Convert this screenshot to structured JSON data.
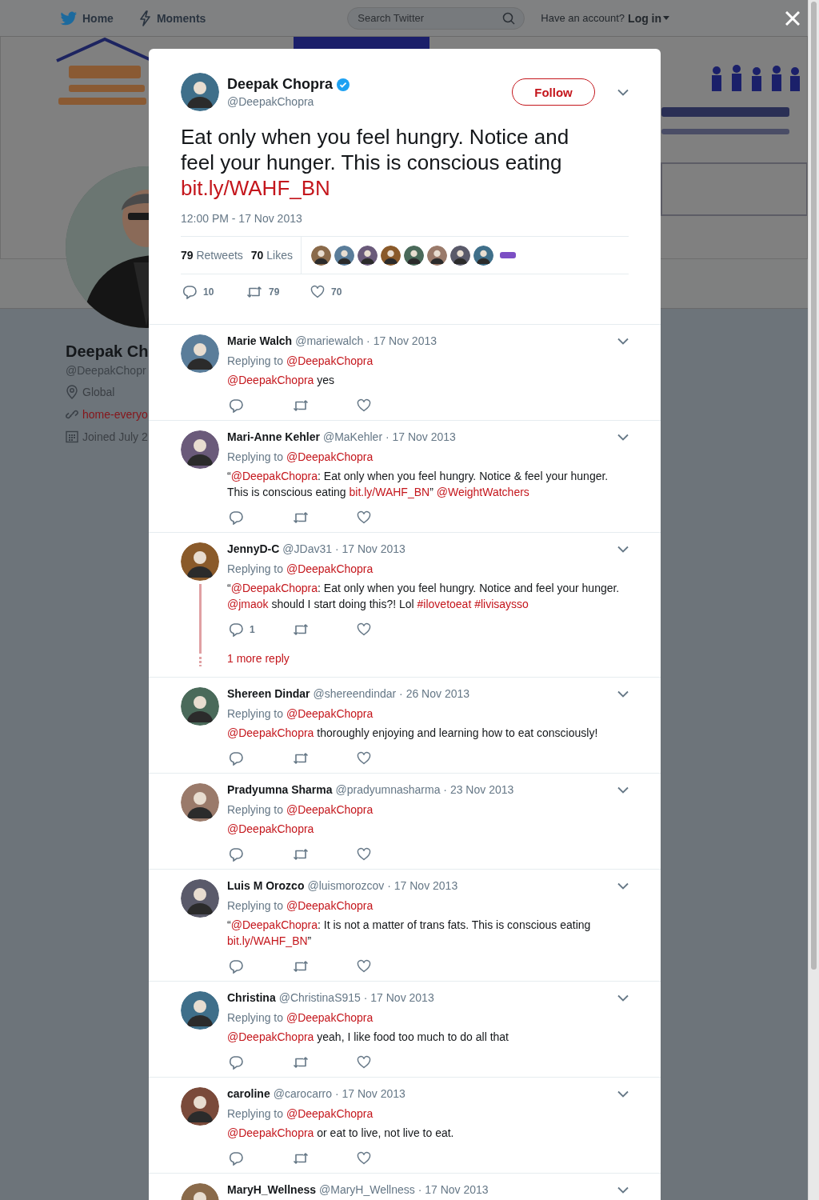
{
  "nav": {
    "items": [
      {
        "label": "Home",
        "kind": "home"
      },
      {
        "label": "Moments",
        "kind": "moments"
      }
    ],
    "search": {
      "placeholder": "Search Twitter"
    },
    "account_prompt": "Have an account?",
    "login": "Log in"
  },
  "profile": {
    "name": "Deepak Ch",
    "handle": "@DeepakChopr",
    "details": [
      {
        "kind": "location",
        "text": "Global"
      },
      {
        "kind": "link",
        "text": "home-everyo"
      },
      {
        "kind": "joined",
        "text": "Joined July 2"
      }
    ]
  },
  "tweet": {
    "name": "Deepak Chopra",
    "verified": true,
    "handle": "@DeepakChopra",
    "follow": "Follow",
    "text": [
      {
        "kind": "plain",
        "text": "Eat only when you feel hungry. Notice and feel your hunger. This is conscious eating "
      },
      {
        "kind": "url",
        "text": "bit.ly/WAHF_BN"
      }
    ],
    "time": "12:00 PM - 17 Nov 2013",
    "retweets": "**79** Retweets",
    "likes": "**70** Likes",
    "likers": [
      {
        "kind": "picture"
      },
      {
        "kind": "picture"
      },
      {
        "kind": "picture"
      },
      {
        "kind": "picture"
      },
      {
        "kind": "picture"
      },
      {
        "kind": "picture"
      },
      {
        "kind": "picture"
      },
      {
        "kind": "picture"
      },
      {
        "kind": "badge"
      }
    ],
    "actions": [
      {
        "kind": "reply",
        "count": "10"
      },
      {
        "kind": "retweet",
        "count": "79"
      },
      {
        "kind": "like",
        "count": "70"
      }
    ]
  },
  "replies": [
    {
      "name": "Marie Walch",
      "meta": "@mariewalch · 17 Nov 2013",
      "replying_label": "Replying to",
      "replying_to": "@DeepakChopra",
      "text": [
        {
          "kind": "mention",
          "text": "@DeepakChopra"
        },
        {
          "kind": "plain",
          "text": " yes"
        }
      ]
    },
    {
      "name": "Mari-Anne Kehler",
      "meta": "@MaKehler · 17 Nov 2013",
      "replying_label": "Replying to",
      "replying_to": "@DeepakChopra",
      "text": [
        {
          "kind": "plain",
          "text": "“"
        },
        {
          "kind": "mention",
          "text": "@DeepakChopra"
        },
        {
          "kind": "plain",
          "text": ": Eat only when you feel hungry. Notice & feel your hunger. This is conscious eating "
        },
        {
          "kind": "url",
          "text": "bit.ly/WAHF_BN"
        },
        {
          "kind": "plain",
          "text": "” "
        },
        {
          "kind": "mention",
          "text": "@WeightWatchers"
        }
      ]
    },
    {
      "name": "JennyD-C",
      "meta": "@JDav31 · 17 Nov 2013",
      "replying_label": "Replying to",
      "replying_to": "@DeepakChopra",
      "text": [
        {
          "kind": "plain",
          "text": "“"
        },
        {
          "kind": "mention",
          "text": "@DeepakChopra"
        },
        {
          "kind": "plain",
          "text": ": Eat only when you feel hungry. Notice and feel your hunger. "
        },
        {
          "kind": "mention",
          "text": "@jmaok"
        },
        {
          "kind": "plain",
          "text": " should I start doing this?! Lol "
        },
        {
          "kind": "hashtag",
          "text": "#ilovetoeat"
        },
        {
          "kind": "hashtag",
          "text": "#livisaysso"
        }
      ],
      "reply_count": "1",
      "more_replies": "1 more reply"
    },
    {
      "name": "Shereen Dindar",
      "meta": "@shereendindar · 26 Nov 2013",
      "replying_label": "Replying to",
      "replying_to": "@DeepakChopra",
      "text": [
        {
          "kind": "mention",
          "text": "@DeepakChopra"
        },
        {
          "kind": "plain",
          "text": " thoroughly enjoying and learning how to eat consciously!"
        }
      ]
    },
    {
      "name": "Pradyumna Sharma",
      "meta": "@pradyumnasharma · 23 Nov 2013",
      "replying_label": "Replying to",
      "replying_to": "@DeepakChopra",
      "text": [
        {
          "kind": "mention",
          "text": "@DeepakChopra"
        }
      ]
    },
    {
      "name": "Luis M Orozco",
      "meta": "@luismorozcov · 17 Nov 2013",
      "replying_label": "Replying to",
      "replying_to": "@DeepakChopra",
      "text": [
        {
          "kind": "plain",
          "text": "“"
        },
        {
          "kind": "mention",
          "text": "@DeepakChopra"
        },
        {
          "kind": "plain",
          "text": ": It is not a matter of trans fats. This is conscious eating "
        },
        {
          "kind": "url",
          "text": "bit.ly/WAHF_BN"
        },
        {
          "kind": "plain",
          "text": "”"
        }
      ]
    },
    {
      "name": "Christina",
      "meta": "@ChristinaS915 · 17 Nov 2013",
      "replying_label": "Replying to",
      "replying_to": "@DeepakChopra",
      "text": [
        {
          "kind": "mention",
          "text": "@DeepakChopra"
        },
        {
          "kind": "plain",
          "text": " yeah, I like food too much to do all that"
        }
      ]
    },
    {
      "name": "caroline",
      "meta": "@carocarro · 17 Nov 2013",
      "replying_label": "Replying to",
      "replying_to": "@DeepakChopra",
      "text": [
        {
          "kind": "mention",
          "text": "@DeepakChopra"
        },
        {
          "kind": "plain",
          "text": " or eat to live, not live to eat."
        }
      ]
    },
    {
      "name": "MaryH_Wellness",
      "meta": "@MaryH_Wellness · 17 Nov 2013"
    }
  ]
}
